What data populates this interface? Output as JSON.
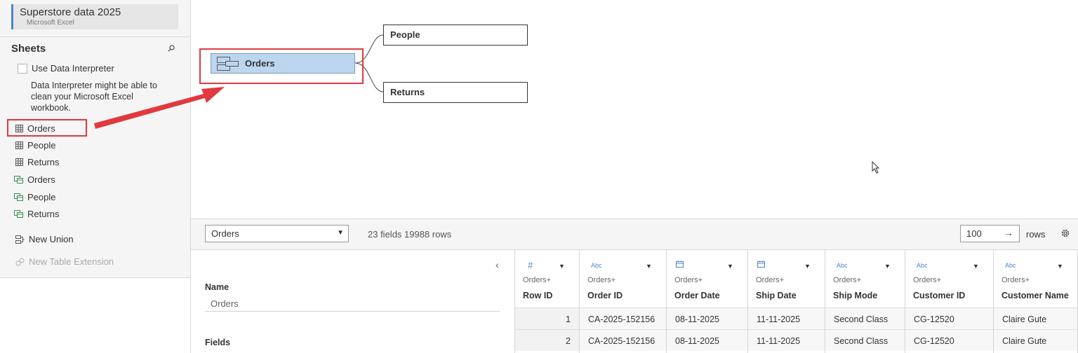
{
  "connection": {
    "name": "Superstore data 2025",
    "type": "Microsoft Excel"
  },
  "sidebar": {
    "sheets_title": "Sheets",
    "interpreter_label": "Use Data Interpreter",
    "interpreter_note": "Data Interpreter might be able to clean your Microsoft Excel workbook.",
    "sheets": [
      {
        "label": "Orders",
        "kind": "sheet"
      },
      {
        "label": "People",
        "kind": "sheet"
      },
      {
        "label": "Returns",
        "kind": "sheet"
      },
      {
        "label": "Orders",
        "kind": "named-range"
      },
      {
        "label": "People",
        "kind": "named-range"
      },
      {
        "label": "Returns",
        "kind": "named-range"
      }
    ],
    "new_union": "New Union",
    "new_table_extension": "New Table Extension"
  },
  "canvas": {
    "root_table": "Orders",
    "related_tables": [
      "People",
      "Returns"
    ],
    "highlight_color": "#e0393e",
    "selected_fill": "#bcd6f0"
  },
  "toolbar": {
    "table_select": "Orders",
    "field_info": "23 fields 19988 rows",
    "rows_value": "100",
    "rows_label": "rows"
  },
  "metadata": {
    "name_label": "Name",
    "name_value": "Orders",
    "fields_label": "Fields"
  },
  "grid": {
    "columns": [
      {
        "type_icon": "#",
        "source": "Orders+",
        "name": "Row ID"
      },
      {
        "type_icon": "Abc",
        "source": "Orders+",
        "name": "Order ID"
      },
      {
        "type_icon": "calendar",
        "source": "Orders+",
        "name": "Order Date"
      },
      {
        "type_icon": "calendar",
        "source": "Orders+",
        "name": "Ship Date"
      },
      {
        "type_icon": "Abc",
        "source": "Orders+",
        "name": "Ship Mode"
      },
      {
        "type_icon": "Abc",
        "source": "Orders+",
        "name": "Customer ID"
      },
      {
        "type_icon": "Abc",
        "source": "Orders+",
        "name": "Customer Name"
      }
    ],
    "rows": [
      [
        "1",
        "CA-2025-152156",
        "08-11-2025",
        "11-11-2025",
        "Second Class",
        "CG-12520",
        "Claire Gute"
      ],
      [
        "2",
        "CA-2025-152156",
        "08-11-2025",
        "11-11-2025",
        "Second Class",
        "CG-12520",
        "Claire Gute"
      ]
    ]
  }
}
